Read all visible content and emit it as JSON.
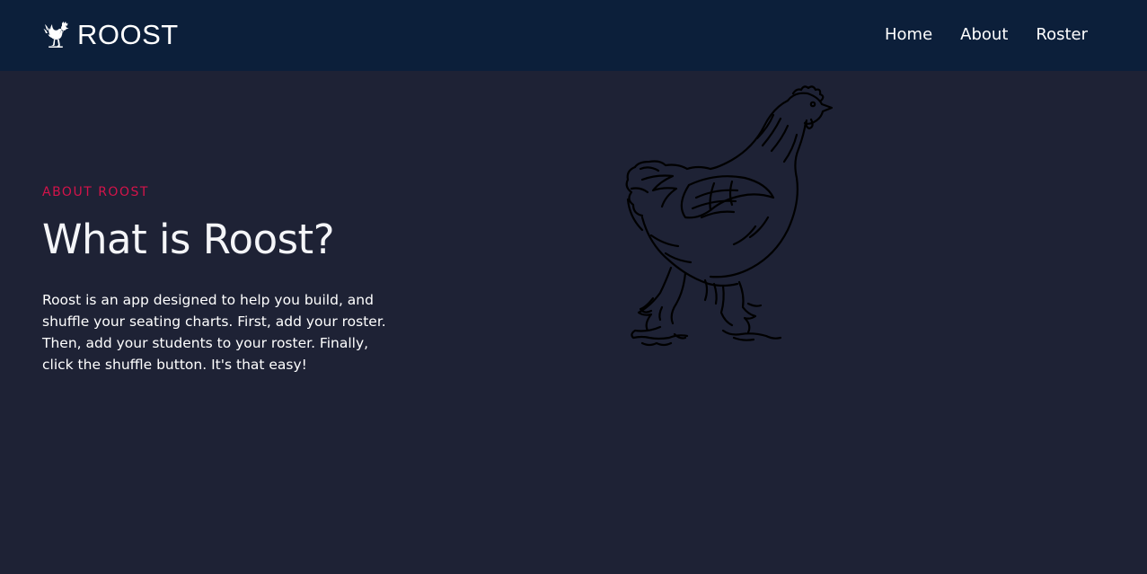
{
  "navbar": {
    "brand_label": "ROOST",
    "brand_icon": "rooster-icon",
    "links": [
      {
        "label": "Home"
      },
      {
        "label": "About"
      },
      {
        "label": "Roster"
      }
    ]
  },
  "about": {
    "eyebrow": "ABOUT ROOST",
    "title": "What is Roost?",
    "description": "Roost is an app designed to help you build, and shuffle your seating charts. First, add your roster. Then, add your students to your roster. Finally, click the shuffle button. It's that easy!"
  },
  "illustration": {
    "icon": "chicken-illustration"
  },
  "colors": {
    "navbar_bg": "#0c1f3a",
    "page_bg": "#1e2235",
    "accent": "#d4134a",
    "text": "#ffffff"
  }
}
